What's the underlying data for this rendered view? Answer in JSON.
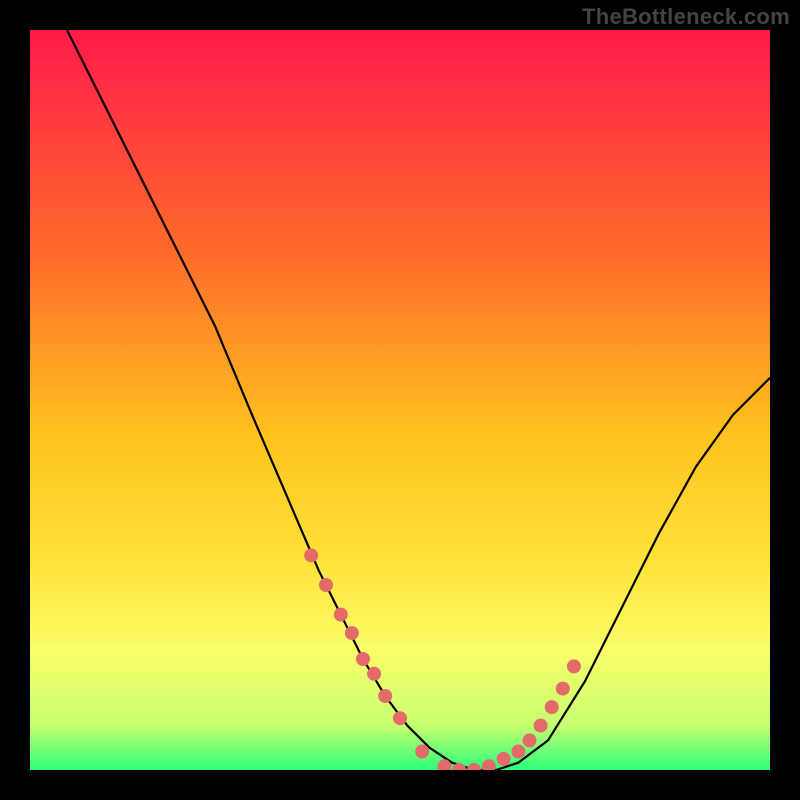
{
  "watermark": "TheBottleneck.com",
  "chart_data": {
    "type": "line",
    "title": "",
    "xlabel": "",
    "ylabel": "",
    "xlim": [
      0,
      100
    ],
    "ylim": [
      0,
      100
    ],
    "grid": false,
    "legend": false,
    "background_gradient_stops": [
      {
        "offset": 0.0,
        "color": "#ff1a4b"
      },
      {
        "offset": 0.3,
        "color": "#ff6a2a"
      },
      {
        "offset": 0.55,
        "color": "#ffc31e"
      },
      {
        "offset": 0.72,
        "color": "#ffe23a"
      },
      {
        "offset": 0.84,
        "color": "#faff6a"
      },
      {
        "offset": 0.94,
        "color": "#c6ff70"
      },
      {
        "offset": 1.0,
        "color": "#2dff7a"
      }
    ],
    "series": [
      {
        "name": "curve",
        "color": "#000000",
        "x": [
          5,
          10,
          15,
          20,
          25,
          30,
          33,
          36,
          39,
          42,
          45,
          48,
          51,
          54,
          57,
          60,
          63,
          66,
          70,
          75,
          80,
          85,
          90,
          95,
          100
        ],
        "y": [
          100,
          90,
          80,
          70,
          60,
          48,
          41,
          34,
          27,
          21,
          15,
          10,
          6,
          3,
          1,
          0,
          0,
          1,
          4,
          12,
          22,
          32,
          41,
          48,
          53
        ]
      }
    ],
    "markers": {
      "name": "highlight-dots",
      "color": "#e46a6a",
      "radius": 7,
      "x": [
        38,
        40,
        42,
        43.5,
        45,
        46.5,
        48,
        50,
        53,
        56,
        58,
        60,
        62,
        64,
        66,
        67.5,
        69,
        70.5,
        72,
        73.5
      ],
      "y": [
        29,
        25,
        21,
        18.5,
        15,
        13,
        10,
        7,
        2.5,
        0.5,
        0,
        0,
        0.5,
        1.5,
        2.5,
        4,
        6,
        8.5,
        11,
        14
      ]
    }
  }
}
